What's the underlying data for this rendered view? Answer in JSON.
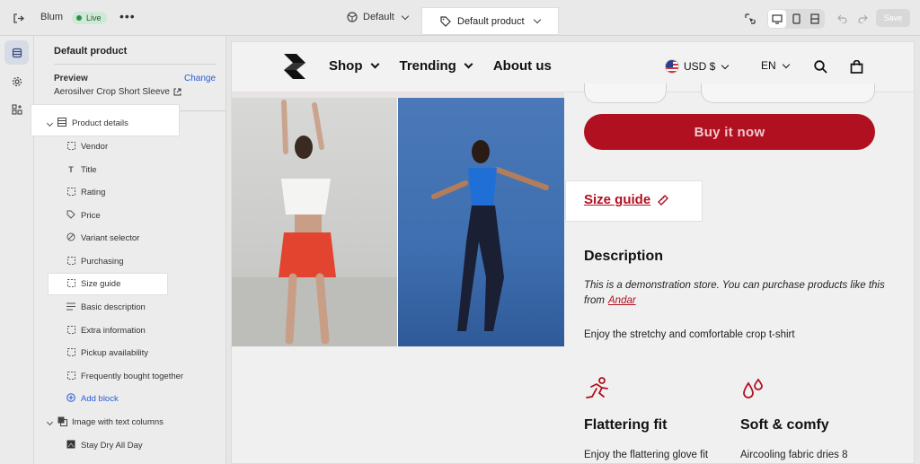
{
  "topbar": {
    "store_name": "Blum",
    "live_label": "Live",
    "theme_label": "Default",
    "template_label": "Default product",
    "save_label": "Save"
  },
  "sidebar": {
    "title": "Default product",
    "preview_label": "Preview",
    "change_label": "Change",
    "preview_value": "Aerosilver Crop Short Sleeve",
    "section_label": "Product details",
    "blocks": [
      {
        "label": "Vendor",
        "icon": "dashed-square-icon"
      },
      {
        "label": "Title",
        "icon": "title-icon"
      },
      {
        "label": "Rating",
        "icon": "dashed-square-icon"
      },
      {
        "label": "Price",
        "icon": "price-tag-icon"
      },
      {
        "label": "Variant selector",
        "icon": "variant-icon"
      },
      {
        "label": "Purchasing",
        "icon": "dashed-square-icon"
      },
      {
        "label": "Size guide",
        "icon": "dashed-square-icon"
      },
      {
        "label": "Basic description",
        "icon": "text-lines-icon"
      },
      {
        "label": "Extra information",
        "icon": "dashed-square-icon"
      },
      {
        "label": "Pickup availability",
        "icon": "dashed-square-icon"
      },
      {
        "label": "Frequently bought together",
        "icon": "dashed-square-icon"
      }
    ],
    "add_block_label": "Add block",
    "section2_label": "Image with text columns",
    "section2_child": "Stay Dry All Day"
  },
  "store": {
    "nav": [
      "Shop",
      "Trending",
      "About us"
    ],
    "currency": "USD $",
    "language": "EN",
    "buy_label": "Buy it now",
    "size_guide_label": "Size guide",
    "description_title": "Description",
    "description_text": "This is a demonstration store. You can purchase products like this from",
    "description_link": "Andar",
    "description_plain": "Enjoy the stretchy and comfortable crop t-shirt",
    "features": [
      {
        "title": "Flattering fit",
        "text": "Enjoy the flattering glove fit",
        "icon": "runner-icon"
      },
      {
        "title": "Soft & comfy",
        "text": "Aircooling fabric dries 8",
        "icon": "droplets-icon"
      }
    ]
  },
  "colors": {
    "accent": "#b01020",
    "link_blue": "#2a5bd7"
  }
}
